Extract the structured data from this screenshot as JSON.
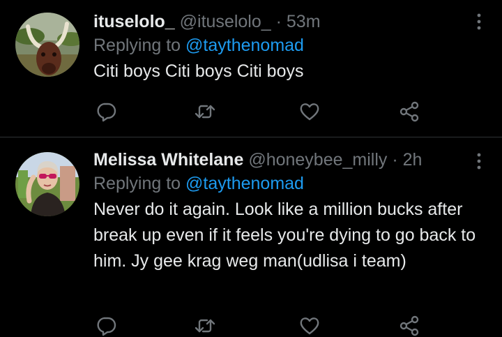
{
  "tweets": [
    {
      "display_name": "ituselolo_",
      "handle": "@ituselolo_",
      "separator": "·",
      "time": "53m",
      "replying_label": "Replying to",
      "replying_to": "@taythenomad",
      "text": "Citi boys Citi boys Citi boys",
      "avatar_icon": "bull-photo-avatar"
    },
    {
      "display_name": "Melissa Whitelane",
      "handle": "@honeybee_milly",
      "separator": "·",
      "time": "2h",
      "replying_label": "Replying to",
      "replying_to": "@taythenomad",
      "text": "Never do it again. Look like a million bucks after break up even if it feels you're dying to go back to him. Jy gee krag weg man(udlisa i team)",
      "avatar_icon": "woman-sunglasses-photo-avatar"
    }
  ],
  "actions": [
    "reply-icon",
    "retweet-icon",
    "like-icon",
    "share-icon"
  ],
  "colors": {
    "background": "#000000",
    "text": "#e7e9ea",
    "muted": "#71767b",
    "mention": "#1d9bf0",
    "divider": "#2f3336"
  }
}
